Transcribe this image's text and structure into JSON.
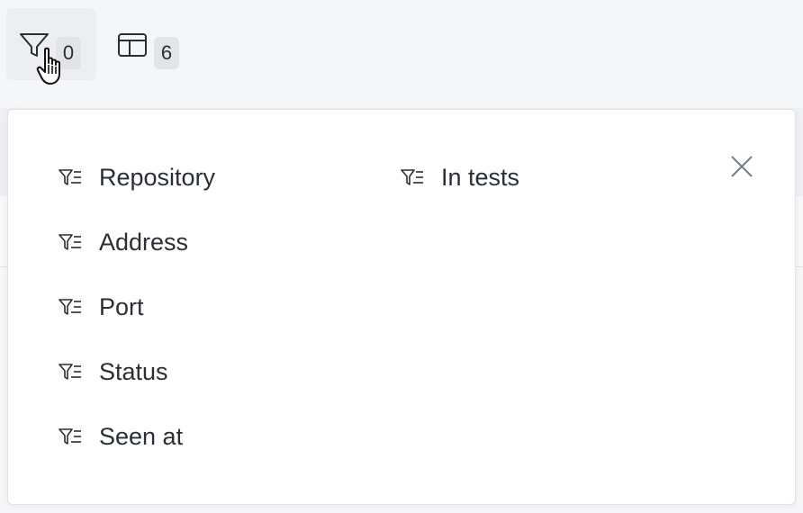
{
  "toolbar": {
    "filter_count": "0",
    "columns_count": "6"
  },
  "popover": {
    "filters": [
      {
        "label": "Repository"
      },
      {
        "label": "Address"
      },
      {
        "label": "Port"
      },
      {
        "label": "Status"
      },
      {
        "label": "Seen at"
      },
      {
        "label": "In tests"
      }
    ]
  },
  "icons": {
    "filter": "funnel-icon",
    "columns": "table-columns-icon",
    "filter_item": "funnel-list-icon",
    "close": "close-icon",
    "cursor": "hand-pointer-icon"
  },
  "colors": {
    "text": "#2a2f36",
    "badge_bg": "#e2e4e8",
    "active_button_bg": "#eceef1",
    "popover_bg": "#ffffff"
  }
}
